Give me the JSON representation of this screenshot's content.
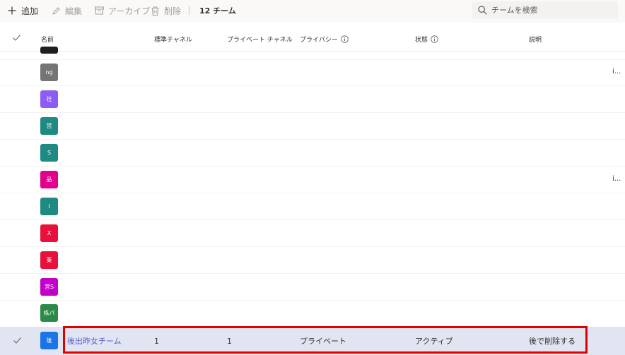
{
  "toolbar": {
    "add_label": "追加",
    "edit_label": "編集",
    "archive_label": "アーカイブ",
    "delete_label": "削除",
    "team_count": "12 チーム"
  },
  "search": {
    "placeholder": "チームを検索"
  },
  "columns": {
    "name": "名前",
    "standard_channels": "標準チャネル",
    "private_channels": "プライベート チャネル",
    "privacy": "プライバシー",
    "status": "状態",
    "description": "説明"
  },
  "rows": [
    {
      "avatar": "ng",
      "color": "#757575",
      "truncated": "i..."
    },
    {
      "avatar": "社",
      "color": "#8c5cf5",
      "truncated": ""
    },
    {
      "avatar": "営",
      "color": "#1e8a82",
      "truncated": ""
    },
    {
      "avatar": "S",
      "color": "#1e8a82",
      "truncated": ""
    },
    {
      "avatar": "品",
      "color": "#e3008c",
      "truncated": "i..."
    },
    {
      "avatar": "I",
      "color": "#1e8a82",
      "truncated": ""
    },
    {
      "avatar": "X",
      "color": "#e8113b",
      "truncated": ""
    },
    {
      "avatar": "業",
      "color": "#e8113b",
      "truncated": ""
    },
    {
      "avatar": "営S",
      "color": "#c300c9",
      "truncated": ""
    },
    {
      "avatar": "株パ",
      "color": "#2c8a48",
      "truncated": ""
    }
  ],
  "selected_row": {
    "avatar": "後",
    "color": "#1b74e8",
    "name": "後出昨女チーム",
    "standard_channels": "1",
    "private_channels": "1",
    "privacy": "プライベート",
    "status": "アクティブ",
    "description": "後で削除する"
  },
  "colors": {
    "accent": "#5b5fc7",
    "selected_bg": "#e1e5f2",
    "highlight": "#e00000"
  }
}
